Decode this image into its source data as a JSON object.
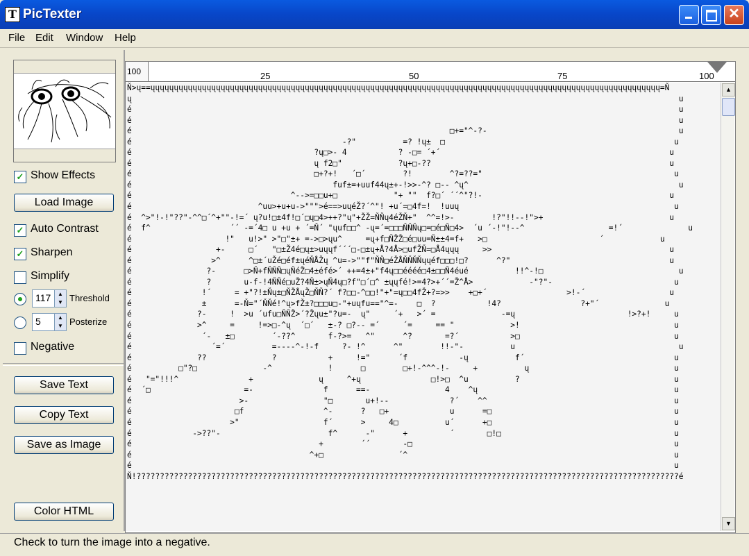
{
  "app": {
    "title": "PicTexter",
    "icon_letter": "T"
  },
  "window_controls": {
    "minimize": "minimize-icon",
    "maximize": "maximize-icon",
    "close": "close-icon",
    "close_glyph": "✕"
  },
  "menu": {
    "items": [
      "File",
      "Edit",
      "Window",
      "Help"
    ]
  },
  "left_panel": {
    "show_effects": {
      "label": "Show Effects",
      "checked": true
    },
    "load_image": "Load Image",
    "auto_contrast": {
      "label": "Auto Contrast",
      "checked": true
    },
    "sharpen": {
      "label": "Sharpen",
      "checked": true
    },
    "simplify": {
      "label": "Simplify",
      "checked": false
    },
    "threshold": {
      "label": "Threshold",
      "value": "117",
      "selected": true
    },
    "posterize": {
      "label": "Posterize",
      "value": "5",
      "selected": false
    },
    "negative": {
      "label": "Negative",
      "checked": false
    },
    "save_text": "Save Text",
    "copy_text": "Copy Text",
    "save_as_image": "Save as Image",
    "color_html": "Color HTML"
  },
  "ruler": {
    "zoom": "100",
    "ticks": [
      "25",
      "50",
      "75",
      "100"
    ]
  },
  "ascii_art": [
    "Ň>ų==ųųųųųųųųųųųųųųųųųųųųųųųųųųųųųųųųųųųųųųųųųųųųųųųųųųųųųųųųųųųųųųųųųųųųųųųųųųųųųųųųųųųųųųųųųųųųųųųųųųųųųųųųųųųųų=Ň",
    "ų                                                                                                                     u",
    "é                                                                                                                     u",
    "é                                                                                                                     u",
    "é                                                                    □+=\"^-?-                                         u",
    "é                                             -?\"          =? !ų±  □                                                 u",
    "é                                       ?ų□>- 4           ? -□= ´+´                                                 u",
    "é                                       ų f2□\"            ?ų+□-??                                                   u",
    "é                                       □+?+!   ´□´        ?!        ^?=??=\"                                         u",
    "é                                           fuf±=+uuf44ų±+-!>>-^? □-- ^ų^                                             u",
    "é                                  ^-->=□□u+□            \"+ \"\"  f?□´ ´´^\"?!-                                        u",
    "é                           ^uu>+u+u->\"\"\">é==>uųéŽ?´^\"! +u´=□4f=!  !uuų                                              u",
    "é  ^>\"!-!\"??\"-^^□´^+\"\"-!=´ ų?u!□±4f!□´□ų□4>++?\"ų\"+ŽŽ=ŇŇų4éŽŇ+\"  ^^=!>-        !?\"!!--!\">+                           u",
    "é  f^                 ´´ -=´4□ u +u + ´=Ň´ \"ųuf□□^ -ų=´=□□□ŇŇŇų□=□é□Ň□4>  ´u ´-!\"!--^                  =!´              u",
    "é                    !\"   u!>\" >\"□\"±+ =->□>ųu^     =ų+f□ŇŽŽ□é□uu=Ň±±4=f+   >□                        ´            u",
    "é                  +-     □´   \"□±Ž4é□ų±>uųųf´´´□-□±ų+Å?4Å>□ufŽŇ=□Å4ųųų     >>                                      u",
    "é                 >^      ^□±´uŽé□éf±ųéŇÅŽų ^u=->\"\"f\"ŇŇ□éŽÅŇŇŇŇųųéf□□□!□?      ^?\"                                  u",
    "é                ?-      □>Ň+fŇŇŇ□ųŇéŽ□4±éfé>´ ++=4±+\"f4ų□□éééé□4±□□Ň4éué          !!^-!□                             u",
    "é                ?       u-f-!4ŇŇé□uŽ?4Ň±>ųŇ4ų□?f\"□´□^ ±ųųfé!>=4?>+´´=Ž^Å>            -\"?\"-                          u",
    "é               !´     = +\"?!±Ňų±□ŇŽÅųŽ□ŇŇ?´ f?□□-^□□!\"+\"=ų□□4fŽ+?=>>    +□+´                 >!-´                  u",
    "é               ±      =-Ň=\"´ŇŇé!^ų>fŽ±?□□□u□-\"+uųfu==\"^=-    □  ?           !4?                 ?+\"´              u",
    "é              ?-     !  >u ´ufu□ŇŇŽ>´?Žųu±\"?u=-  ų\"     ´+   >´ =              -=ų                        !>?+!     u",
    "é              >^     =     !=>□-^ų  ´□´   ±-? □?-- =´     ´=     == \"            >!                                 u",
    "é               ´-   ±□        ´-??^       f-?>=   ^\"      ^?       =?´           >□                                 u",
    "é                 ´=´          =----^-!-f     ?- !^      ^\"        !!-\"-          u                                   u",
    "é              ??              ?           +     !=\"      ´f           -ų          f´                                u",
    "é          □\"?□              -^            !      □        □+!-^^^-!-     +          ų                               u",
    "é   \"=\"!!!^               +              ų     ^+ų               □!>□  ^u          ?                                 u",
    "é  ´□                    =-               f      ==-                4    ^ų                                          u",
    "é                       >-                \"□       u+!--             ?´    ^^                                        u",
    "é                      □f                 ^-      ?   □+             u      =□                                       u",
    "é                     >\"                  f´      >     4□          u´      +□                                       u",
    "é             ->??\"-                       f^      -\"      +         ´       □!□                                     u",
    "é                                        +        ´´       -□                                                        u",
    "é                                      ^+□                ´^                                                         u",
    "é                                                                                                                    u",
    "Ň!????????????????????????????????????????????????????????????????????????????????????????????????????????????????????é"
  ],
  "status": {
    "text": "Check to turn the image into a negative."
  }
}
